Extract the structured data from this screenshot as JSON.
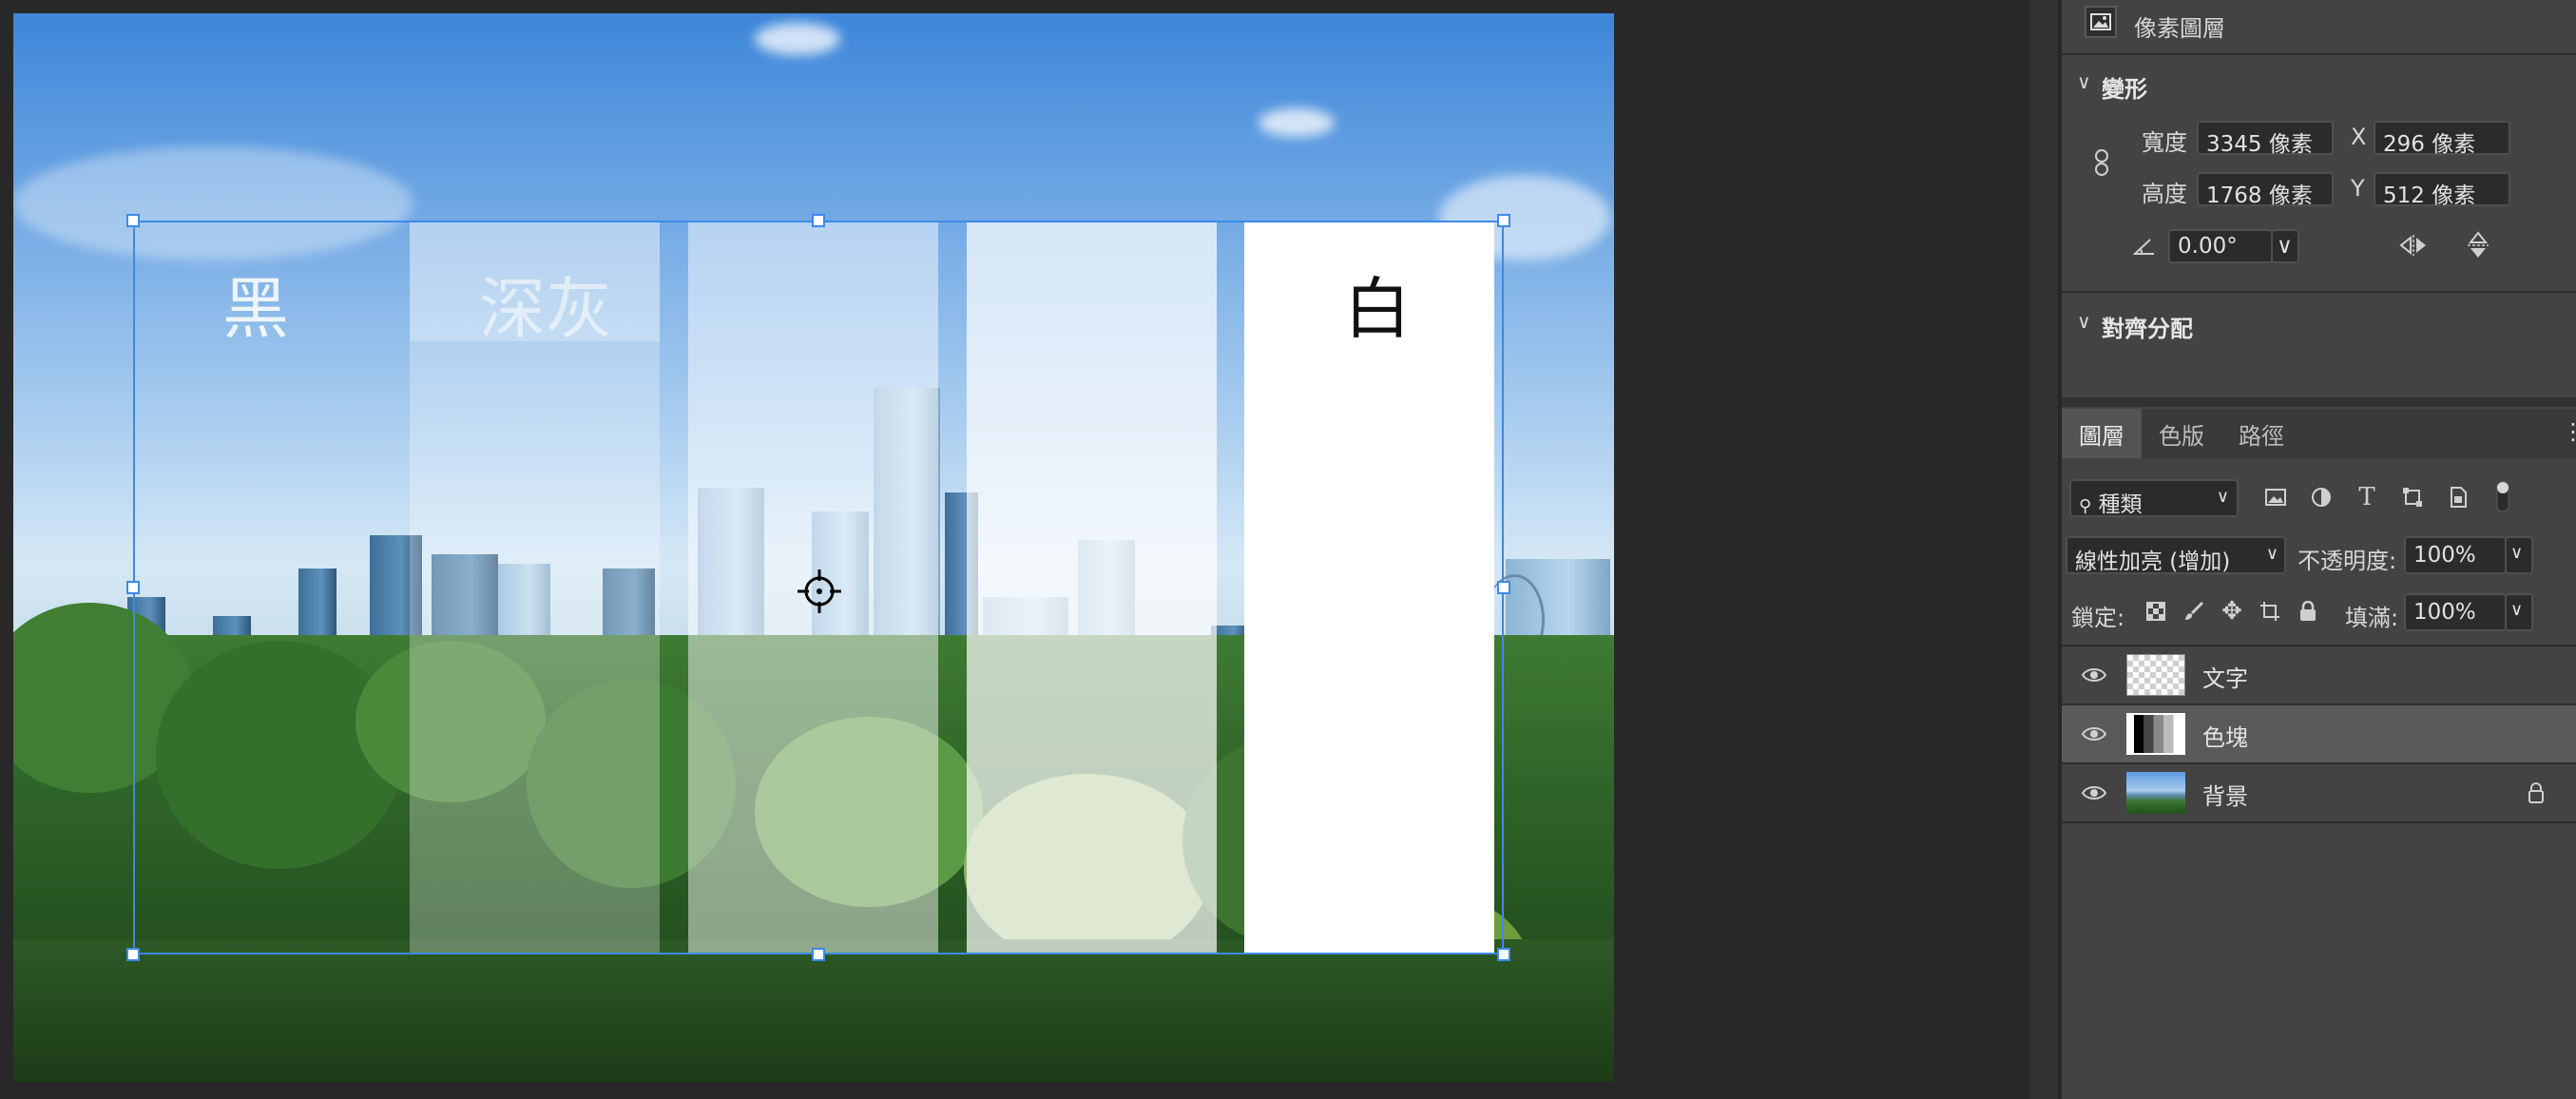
{
  "canvas": {
    "stripe_labels": [
      "黑",
      "深灰",
      "白"
    ]
  },
  "properties": {
    "layer_type": "像素圖層",
    "transform_title": "變形",
    "width_label": "寬度",
    "width_value": "3345 像素",
    "height_label": "高度",
    "height_value": "1768 像素",
    "x_label": "X",
    "x_value": "296 像素",
    "y_label": "Y",
    "y_value": "512 像素",
    "angle_value": "0.00°",
    "align_title": "對齊分配"
  },
  "layers_panel": {
    "tabs": [
      {
        "label": "圖層",
        "active": true
      },
      {
        "label": "色版",
        "active": false
      },
      {
        "label": "路徑",
        "active": false
      }
    ],
    "filter_kind": "種類",
    "blend_mode": "線性加亮 (增加)",
    "opacity_label": "不透明度:",
    "opacity_value": "100%",
    "lock_label": "鎖定:",
    "fill_label": "填滿:",
    "fill_value": "100%",
    "layers": [
      {
        "name": "文字",
        "visible": true,
        "selected": false,
        "locked": false,
        "thumb": "transparent-checker"
      },
      {
        "name": "色塊",
        "visible": true,
        "selected": true,
        "locked": false,
        "thumb": "gray-stripes"
      },
      {
        "name": "背景",
        "visible": true,
        "selected": false,
        "locked": true,
        "thumb": "city-photo"
      }
    ]
  },
  "colors": {
    "selection": "#3c8ae6",
    "panel_bg": "#434343",
    "app_bg": "#282828"
  }
}
